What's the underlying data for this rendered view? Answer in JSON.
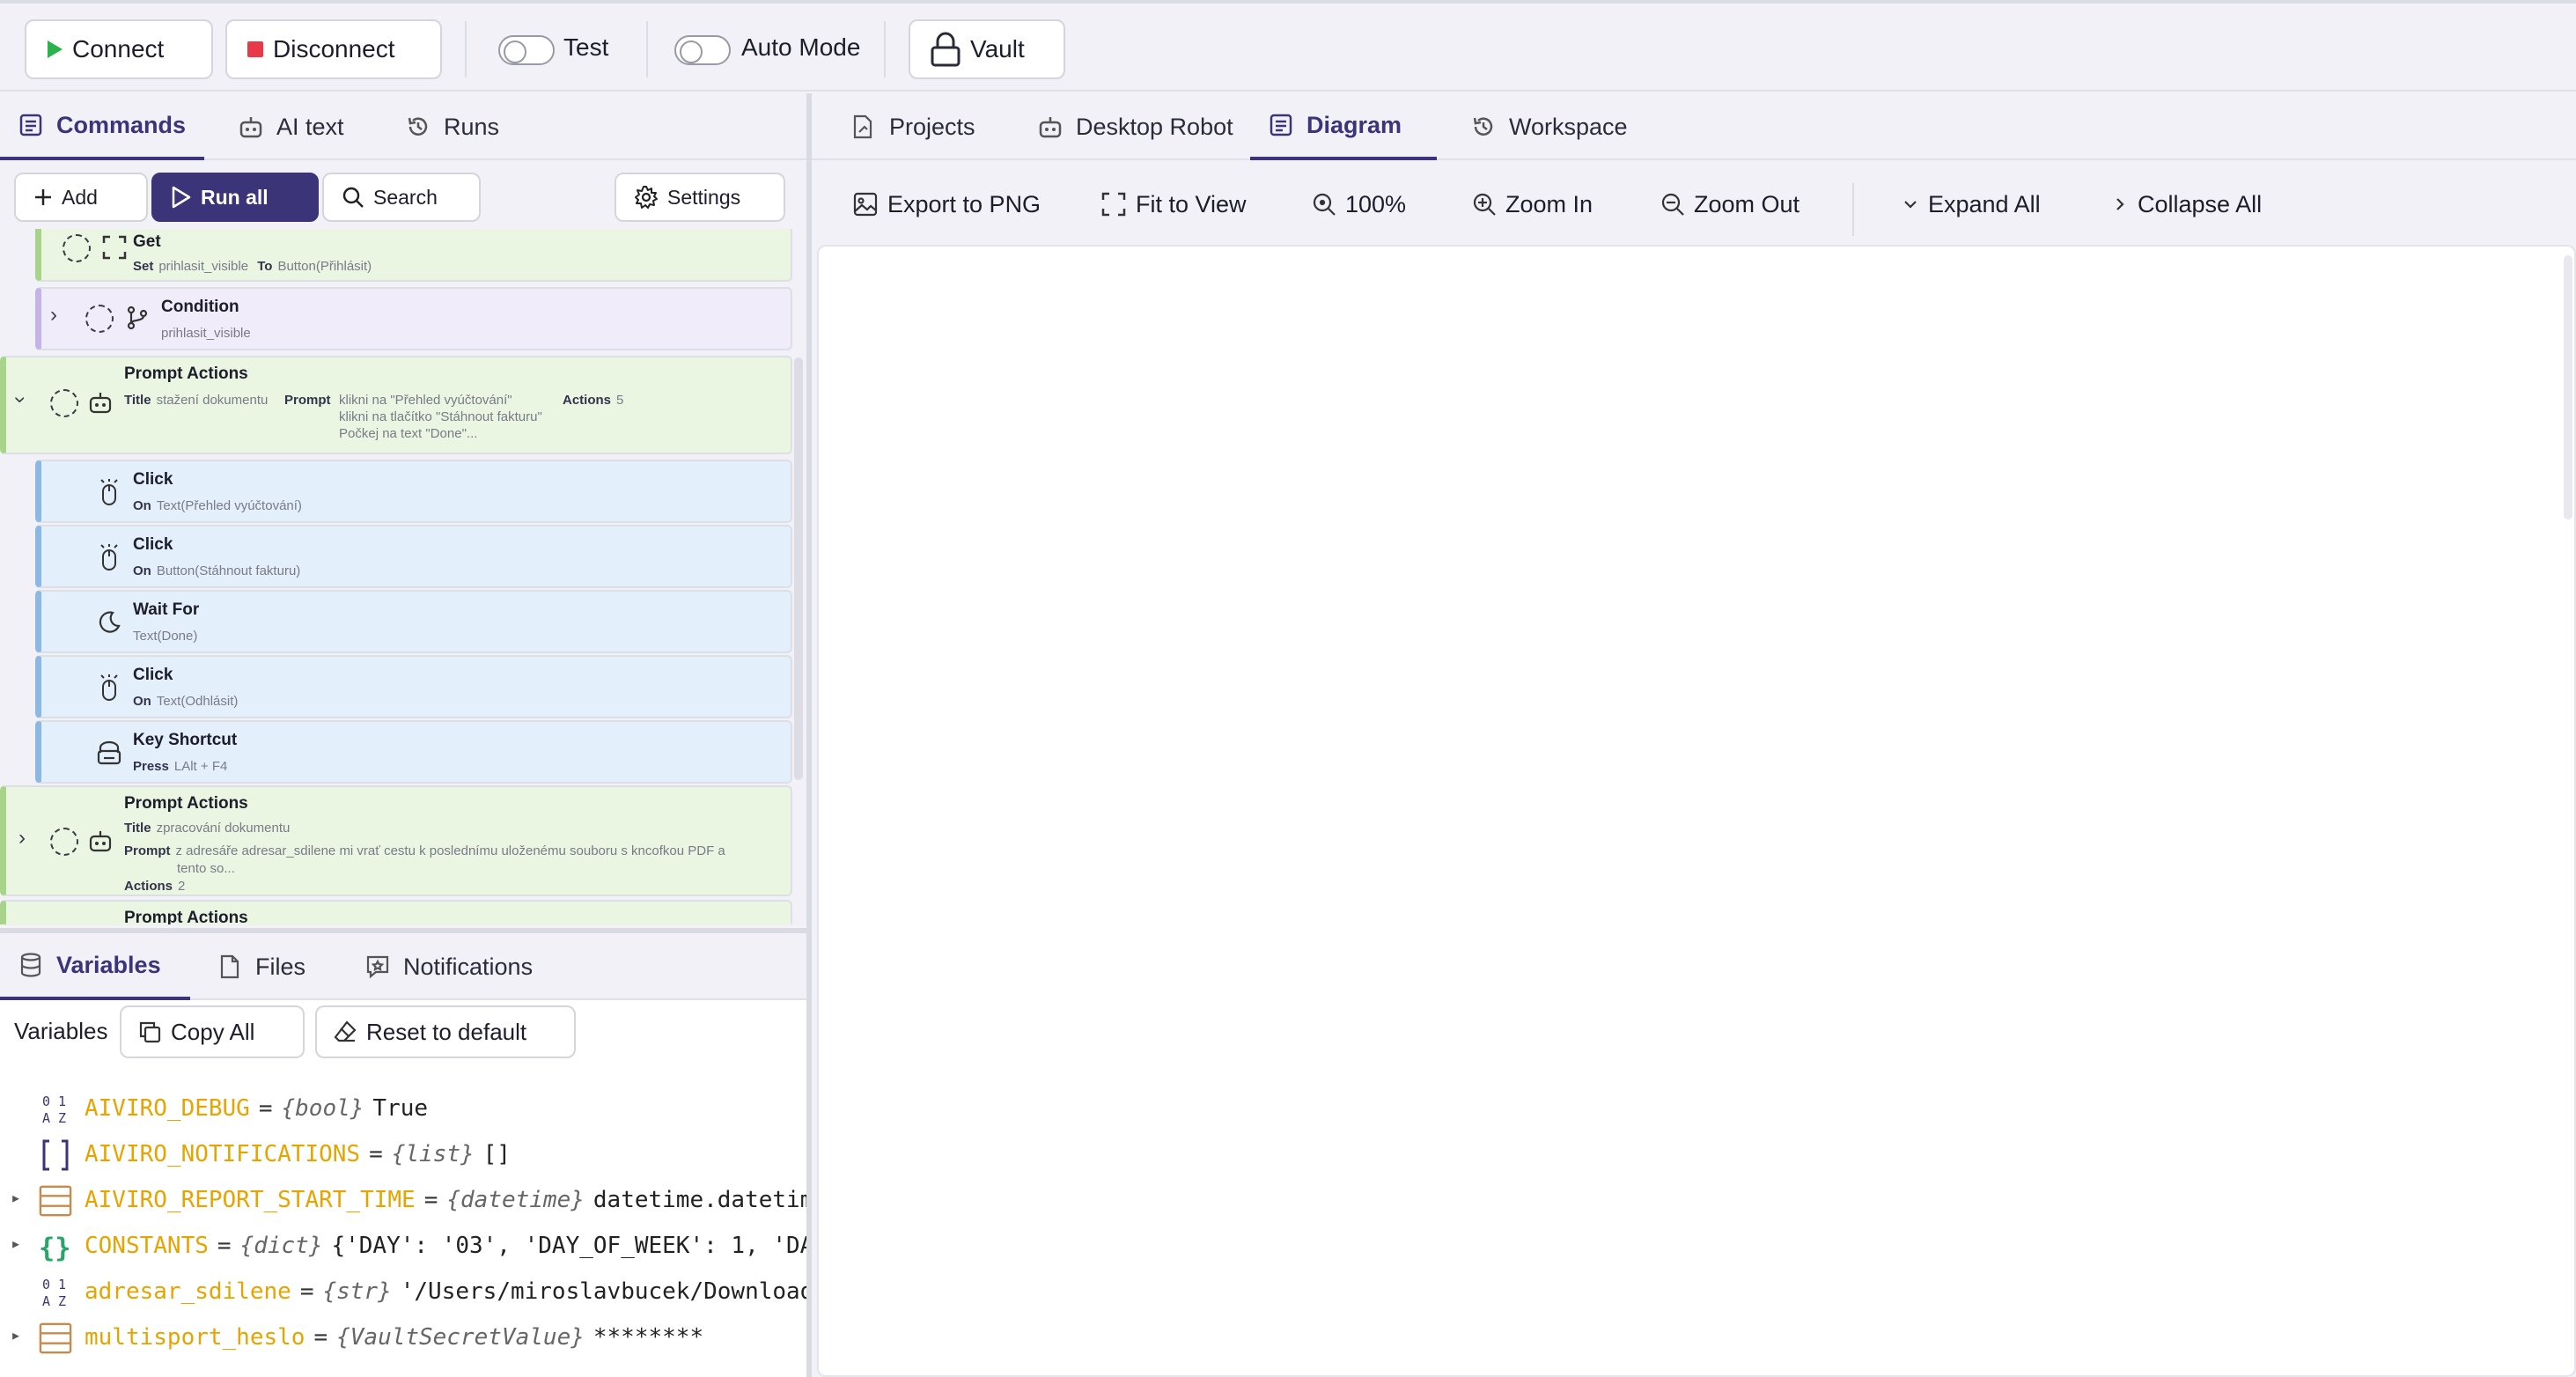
{
  "toolbar": {
    "connect": "Connect",
    "disconnect": "Disconnect",
    "test": "Test",
    "auto_mode": "Auto Mode",
    "vault": "Vault"
  },
  "left_tabs": [
    "Commands",
    "AI text",
    "Runs"
  ],
  "command_bar": {
    "add": "Add",
    "run_all": "Run all",
    "search": "Search",
    "settings": "Settings"
  },
  "commands": [
    {
      "title": "Get",
      "k1": "Set",
      "v1": "prihlasit_visible",
      "k2": "To",
      "v2": "Button(Přihlásit)"
    },
    {
      "title": "Condition",
      "sub": "prihlasit_visible"
    },
    {
      "title": "Prompt Actions",
      "k1": "Title",
      "v1": "stažení dokumentu",
      "k2": "Prompt",
      "p1": "klikni na \"Přehled vyúčtování\"",
      "p2": "klikni na tlačítko \"Stáhnout fakturu\"",
      "p3": "Počkej na text \"Done\"...",
      "k3": "Actions",
      "v3": "5"
    },
    {
      "title": "Click",
      "k1": "On",
      "v1": "Text(Přehled vyúčtování)"
    },
    {
      "title": "Click",
      "k1": "On",
      "v1": "Button(Stáhnout fakturu)"
    },
    {
      "title": "Wait For",
      "sub": "Text(Done)"
    },
    {
      "title": "Click",
      "k1": "On",
      "v1": "Text(Odhlásit)"
    },
    {
      "title": "Key Shortcut",
      "k1": "Press",
      "v1": "LAlt + F4"
    },
    {
      "title": "Prompt Actions",
      "k1": "Title",
      "v1": "zpracování dokumentu",
      "k2": "Prompt",
      "p1": "z adresáře adresar_sdilene mi vrať cestu k poslednímu uloženému souboru s kncofkou PDF a",
      "p2": "tento so...",
      "k3": "Actions",
      "v3": "2"
    },
    {
      "title": "Prompt Actions"
    }
  ],
  "var_tabs": [
    "Variables",
    "Files",
    "Notifications"
  ],
  "var_toolbar": {
    "label": "Variables",
    "copy_all": "Copy All",
    "reset": "Reset to default"
  },
  "variables": [
    {
      "name": "AIVIRO_DEBUG",
      "type": "{bool}",
      "value": "True",
      "icon": "bool"
    },
    {
      "name": "AIVIRO_NOTIFICATIONS",
      "type": "{list}",
      "value": "[]",
      "icon": "list"
    },
    {
      "name": "AIVIRO_REPORT_START_TIME",
      "type": "{datetime}",
      "value": "datetime.datetime",
      "icon": "object"
    },
    {
      "name": "CONSTANTS",
      "type": "{dict}",
      "value": "{'DAY': '03', 'DAY_OF_WEEK': 1, 'DA",
      "icon": "dict"
    },
    {
      "name": "adresar_sdilene",
      "type": "{str}",
      "value": "'/Users/miroslavbucek/Download",
      "icon": "str"
    },
    {
      "name": "multisport_heslo",
      "type": "{VaultSecretValue}",
      "value": "********",
      "icon": "object"
    }
  ],
  "right_tabs": [
    "Projects",
    "Desktop Robot",
    "Diagram",
    "Workspace"
  ],
  "diagram_toolbar": {
    "export": "Export to PNG",
    "fit": "Fit to View",
    "zoom": "100%",
    "zoom_in": "Zoom In",
    "zoom_out": "Zoom Out",
    "expand": "Expand All",
    "collapse": "Collapse All"
  },
  "colors": {
    "accent": "#3b3479",
    "var_name": "#e7a400",
    "play": "#2bb24c",
    "stop": "#e8394b"
  }
}
